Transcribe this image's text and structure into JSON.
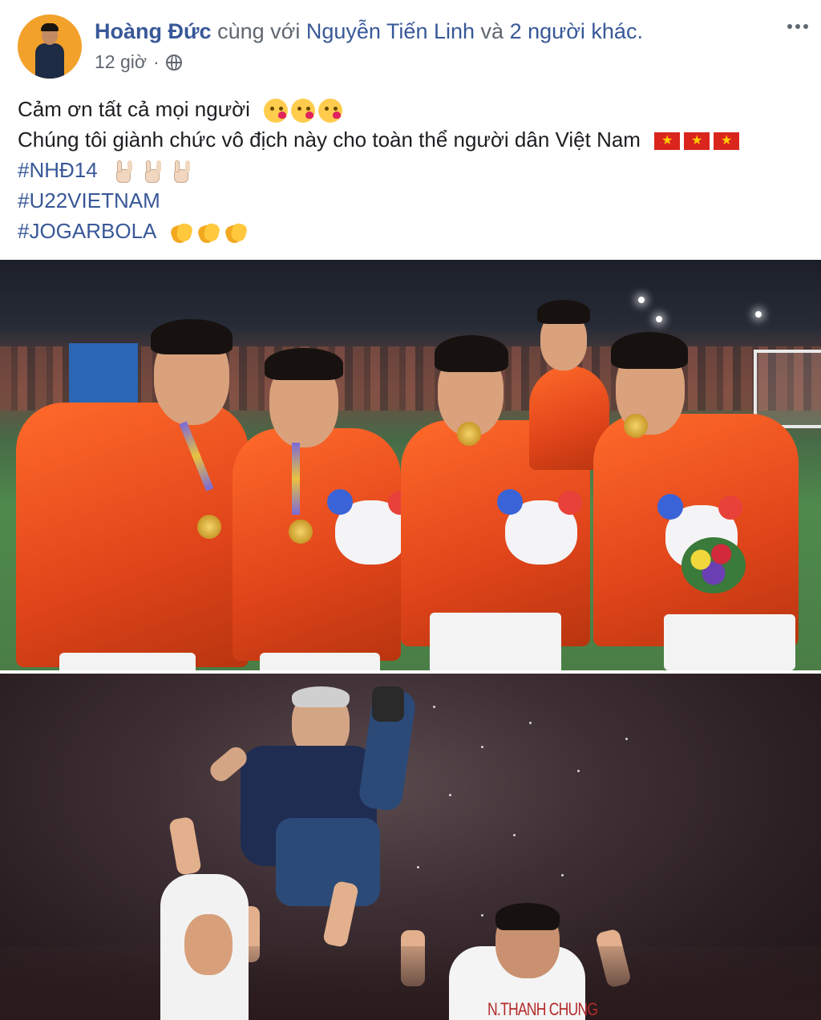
{
  "post": {
    "author": "Hoàng Đức",
    "with_text": "cùng với",
    "tagged": "Nguyễn Tiến Linh",
    "and_text": "và",
    "others": "2 người khác.",
    "time": "12 giờ",
    "separator": "·",
    "privacy_icon": "globe-icon",
    "menu_icon": "more-options-icon",
    "lines": {
      "line1": "Cảm ơn tất cả mọi người",
      "line2": "Chúng tôi giành chức vô địch này cho toàn thể người dân Việt Nam",
      "hashtag1": "#NHĐ14",
      "hashtag2": "#U22VIETNAM",
      "hashtag3": "#JOGARBOLA"
    },
    "emojis": {
      "line1": [
        "kiss-icon",
        "kiss-icon",
        "kiss-icon"
      ],
      "line2": [
        "vietnam-flag-icon",
        "vietnam-flag-icon",
        "vietnam-flag-icon"
      ],
      "hashtag1": [
        "rock-hand-icon",
        "rock-hand-icon",
        "rock-hand-icon"
      ],
      "hashtag3": [
        "clapping-hands-icon",
        "clapping-hands-icon",
        "clapping-hands-icon"
      ]
    }
  },
  "photos": {
    "photo2_jersey_text": "N.THANH CHUNG"
  },
  "colors": {
    "link": "#385898",
    "secondary_text": "#606770",
    "primary_text": "#1c1e21",
    "jacket_orange": "#e0441a",
    "flag_red": "#da251d",
    "flag_star": "#ffcd00"
  }
}
